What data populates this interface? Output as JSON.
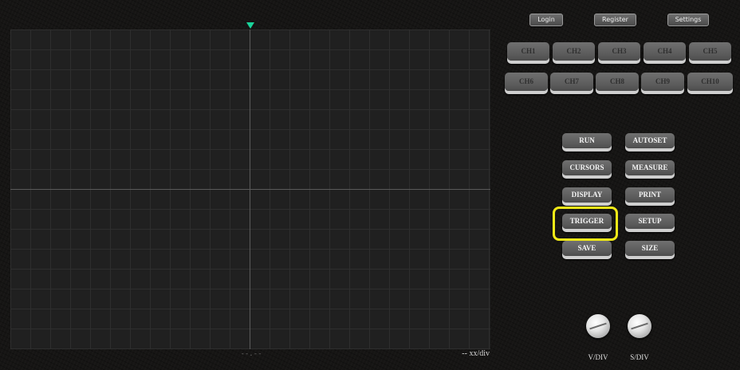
{
  "header": {
    "login_label": "Login",
    "register_label": "Register",
    "settings_label": "Settings"
  },
  "channels": [
    "CH1",
    "CH2",
    "CH3",
    "CH4",
    "CH5",
    "CH6",
    "CH7",
    "CH8",
    "CH9",
    "CH10"
  ],
  "controls": {
    "run": "RUN",
    "autoset": "AUTOSET",
    "cursors": "CURSORS",
    "measure": "MEASURE",
    "display": "DISPLAY",
    "print": "PRINT",
    "trigger": "TRIGGER",
    "setup": "SETUP",
    "save": "SAVE",
    "size": "SIZE"
  },
  "screen": {
    "bottom_center_text": "--.--",
    "scale_text": "-- xx/div"
  },
  "knobs": {
    "vdiv_label": "V/DIV",
    "sdiv_label": "S/DIV"
  },
  "colors": {
    "trigger_marker": "#19d49a",
    "highlight": "#f2ea17"
  }
}
